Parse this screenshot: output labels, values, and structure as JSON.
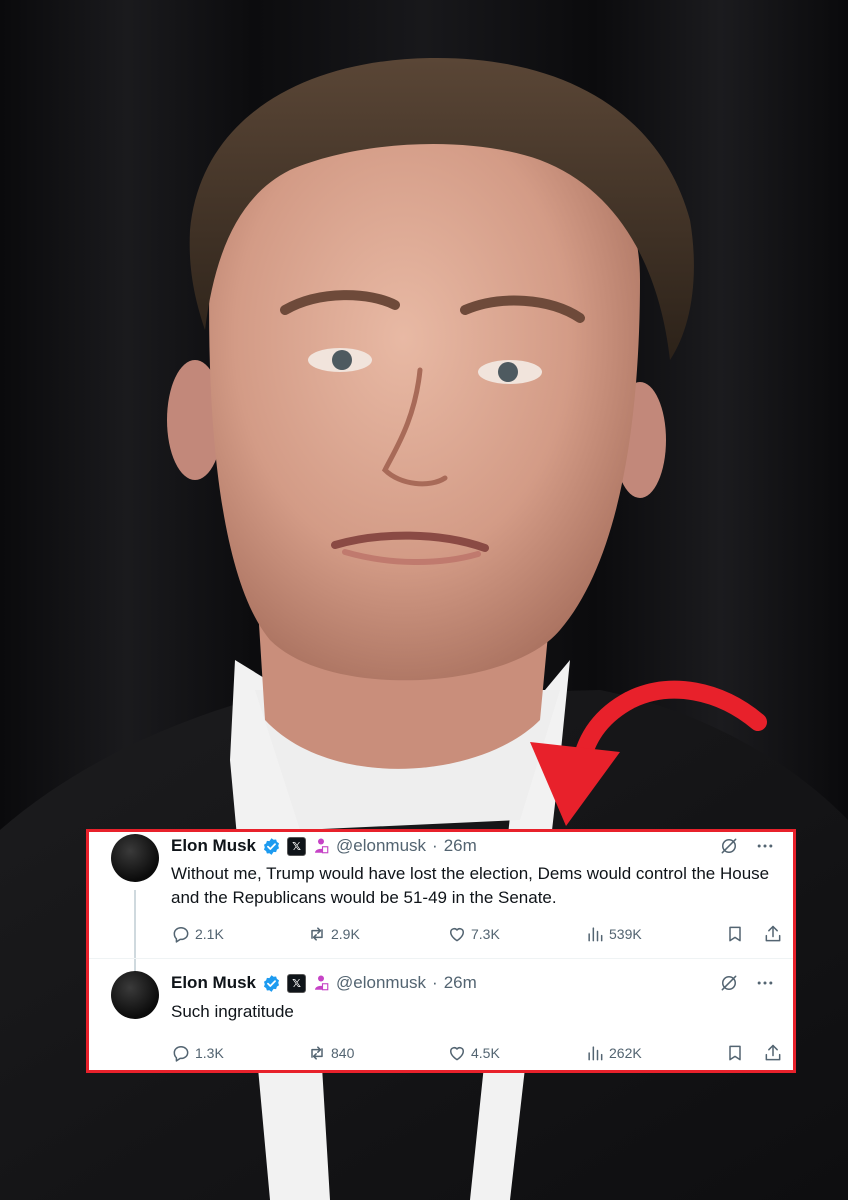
{
  "background": {
    "subject": "photo-portrait-icon"
  },
  "tweets": [
    {
      "name": "Elon Musk",
      "handle": "@elonmusk",
      "separator": "·",
      "time": "26m",
      "text": "Without me, Trump would have lost the election, Dems would control the House and the Republicans would be 51-49 in the Senate.",
      "stats": {
        "replies": "2.1K",
        "retweets": "2.9K",
        "likes": "7.3K",
        "views": "539K"
      }
    },
    {
      "name": "Elon Musk",
      "handle": "@elonmusk",
      "separator": "·",
      "time": "26m",
      "text": "Such ingratitude",
      "stats": {
        "replies": "1.3K",
        "retweets": "840",
        "likes": "4.5K",
        "views": "262K"
      }
    }
  ],
  "colors": {
    "highlight_border": "#e8212b",
    "arrow": "#e8212b",
    "verified": "#1d9bf0",
    "affiliate": "#c643c6",
    "muted_text": "#536471"
  }
}
